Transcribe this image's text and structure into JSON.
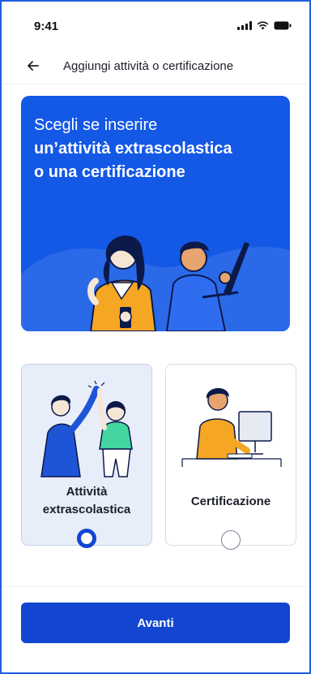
{
  "status_bar": {
    "time": "9:41"
  },
  "header": {
    "title": "Aggiungi attività o certificazione"
  },
  "hero": {
    "line1": "Scegli se inserire",
    "line2": "un’attività extrascolastica",
    "line3": "o una certificazione"
  },
  "options": [
    {
      "label_line1": "Attività",
      "label_line2": "extrascolastica",
      "selected": true
    },
    {
      "label_line1": "Certificazione",
      "selected": false
    }
  ],
  "actions": {
    "next_label": "Avanti"
  },
  "colors": {
    "brand_blue": "#1458e6",
    "button_blue": "#1246d0",
    "selected_card_bg": "#e8edfa"
  }
}
